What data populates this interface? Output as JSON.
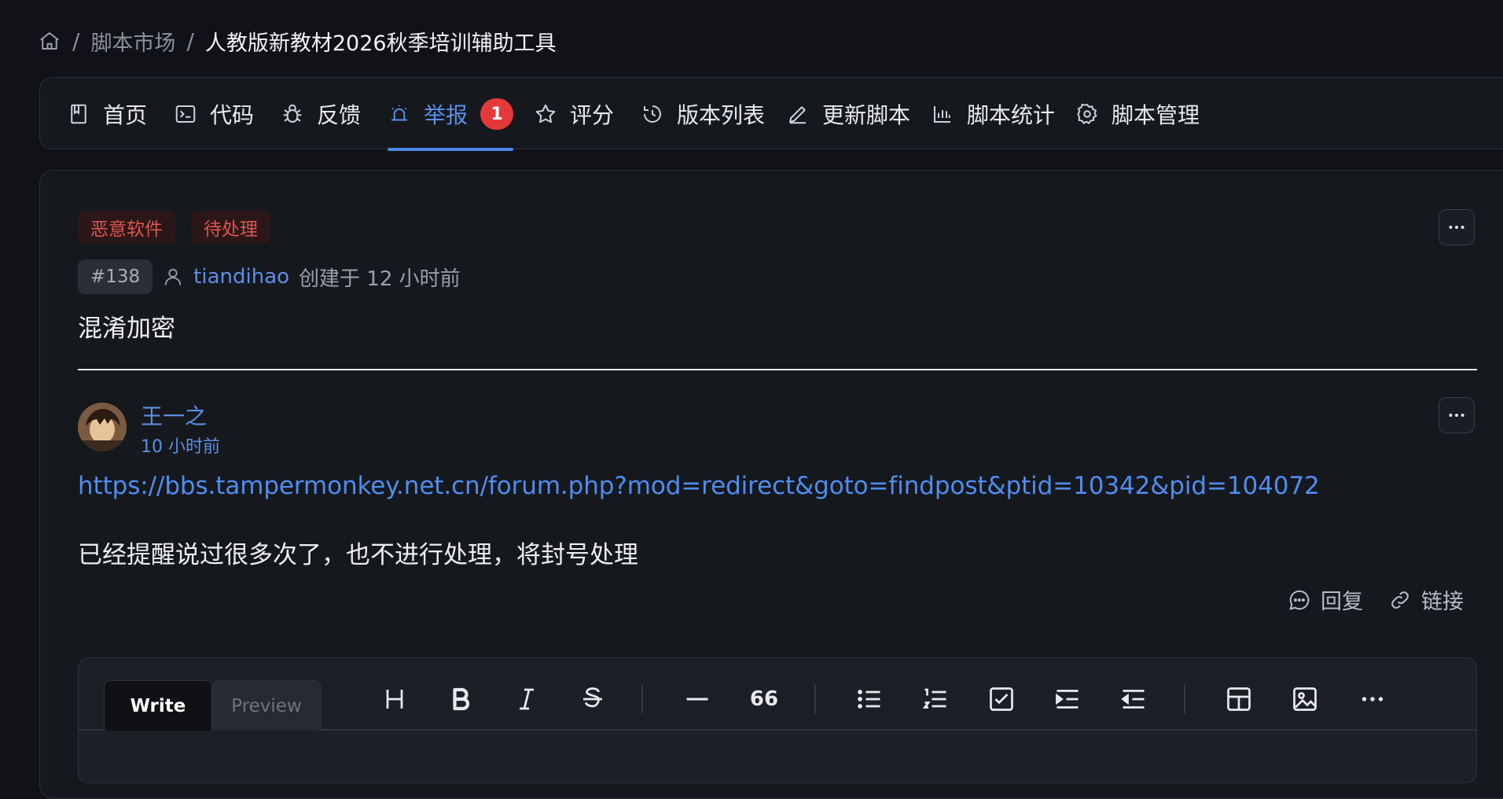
{
  "breadcrumb": {
    "home_icon": "home-icon",
    "separator": "/",
    "market": "脚本市场",
    "current": "人教版新教材2026秋季培训辅助工具"
  },
  "nav": {
    "tabs": [
      {
        "label": "首页",
        "icon": "book-icon"
      },
      {
        "label": "代码",
        "icon": "terminal-icon"
      },
      {
        "label": "反馈",
        "icon": "bug-icon"
      },
      {
        "label": "举报",
        "icon": "alarm-icon",
        "badge": "1",
        "active": true
      },
      {
        "label": "评分",
        "icon": "star-icon"
      },
      {
        "label": "版本列表",
        "icon": "history-icon"
      },
      {
        "label": "更新脚本",
        "icon": "pencil-icon"
      },
      {
        "label": "脚本统计",
        "icon": "bar-chart-icon"
      },
      {
        "label": "脚本管理",
        "icon": "gear-icon"
      }
    ]
  },
  "report": {
    "tags": [
      "恶意软件",
      "待处理"
    ],
    "number": "#138",
    "user": "tiandihao",
    "created": "创建于 12 小时前",
    "title": "混淆加密"
  },
  "comment": {
    "author": "王一之",
    "time": "10 小时前",
    "url": "https://bbs.tampermonkey.net.cn/forum.php?mod=redirect&goto=findpost&ptid=10342&pid=104072",
    "text": "已经提醒说过很多次了，也不进行处理，将封号处理",
    "reply_label": "回复",
    "link_label": "链接"
  },
  "editor": {
    "write_label": "Write",
    "preview_label": "Preview",
    "quote_glyph": "66"
  },
  "colors": {
    "accent": "#4a86e8",
    "badge": "#e5383b",
    "tag_text": "#e0554f",
    "background": "#101217"
  }
}
